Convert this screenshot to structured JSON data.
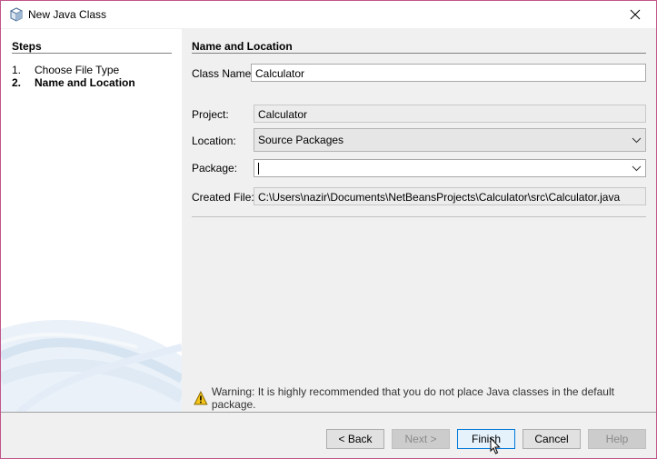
{
  "window": {
    "title": "New Java Class",
    "icon": "java-class-cube-icon",
    "close_icon": "close-icon",
    "border_color": "#c2558a"
  },
  "steps": {
    "heading": "Steps",
    "items": [
      {
        "num": "1.",
        "label": "Choose File Type",
        "current": false
      },
      {
        "num": "2.",
        "label": "Name and Location",
        "current": true
      }
    ]
  },
  "form": {
    "heading": "Name and Location",
    "class_name": {
      "label": "Class Name:",
      "value": "Calculator"
    },
    "project": {
      "label": "Project:",
      "value": "Calculator"
    },
    "location": {
      "label": "Location:",
      "value": "Source Packages"
    },
    "package": {
      "label": "Package:",
      "value": ""
    },
    "created_file": {
      "label": "Created File:",
      "value": "C:\\Users\\nazir\\Documents\\NetBeansProjects\\Calculator\\src\\Calculator.java"
    }
  },
  "warning": {
    "icon": "warning-triangle-icon",
    "text": "Warning: It is highly recommended that you do not place Java classes in the default package."
  },
  "buttons": {
    "back": "< Back",
    "next": "Next >",
    "finish": "Finish",
    "cancel": "Cancel",
    "help": "Help"
  }
}
